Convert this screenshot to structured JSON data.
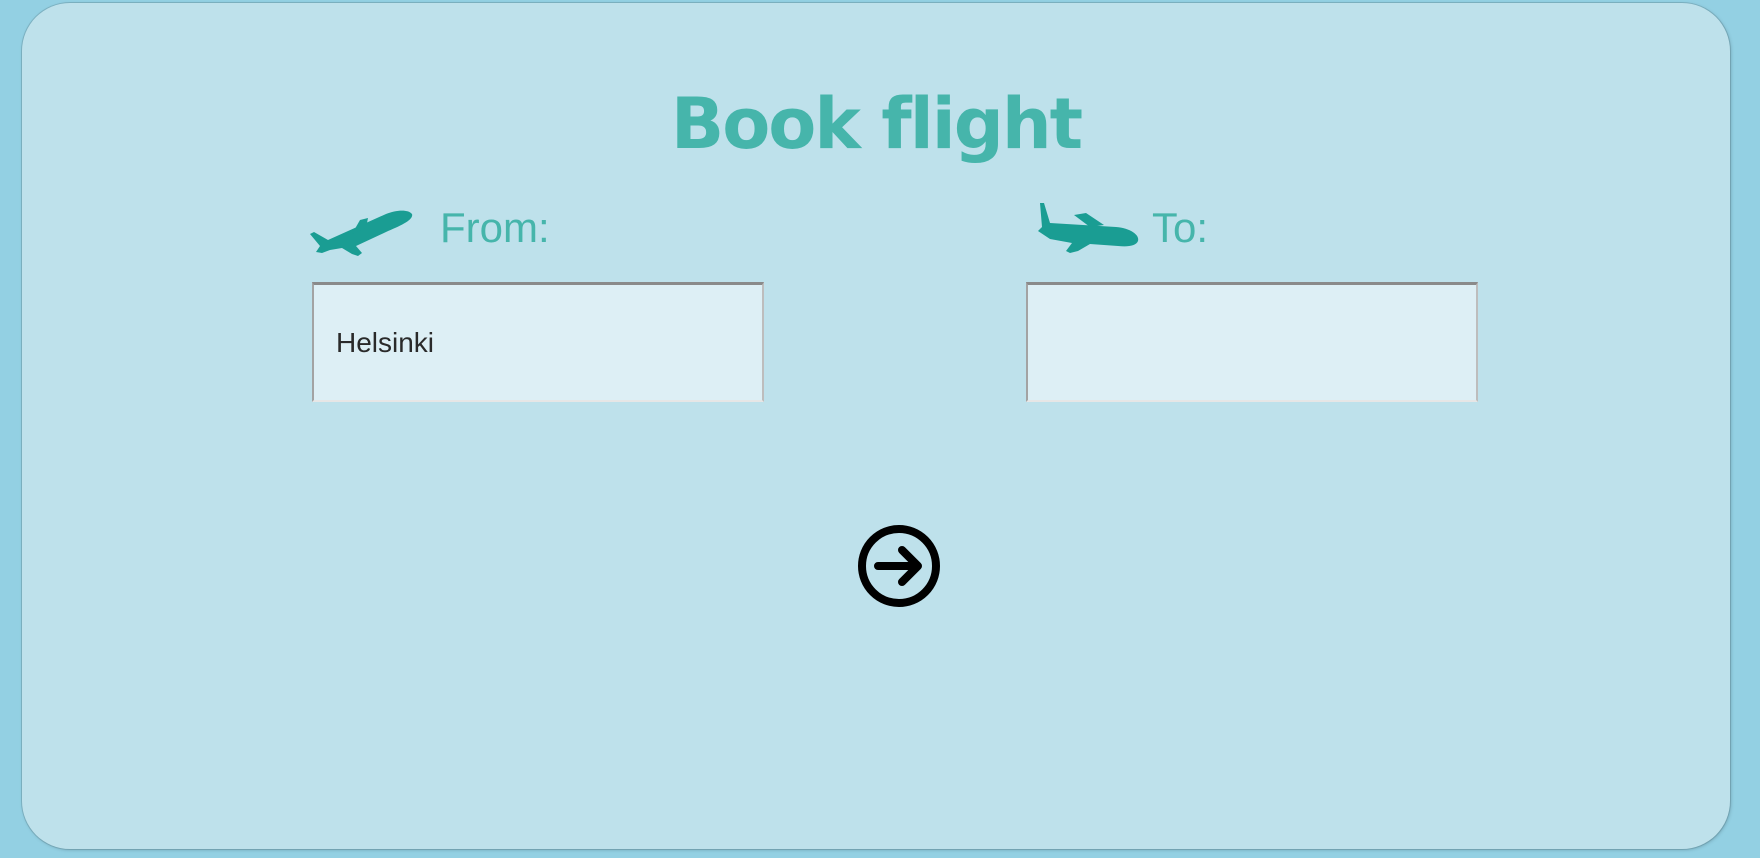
{
  "page": {
    "title": "Book flight"
  },
  "form": {
    "from": {
      "label": "From:",
      "value": "Helsinki",
      "icon": "plane-takeoff-icon"
    },
    "to": {
      "label": "To:",
      "value": "",
      "icon": "plane-landing-icon"
    },
    "submit": {
      "icon": "arrow-right-circle-icon"
    }
  },
  "colors": {
    "page_background": "#93d0e3",
    "panel_background": "#bee1eb",
    "accent_text": "#46b5ab",
    "plane_icon": "#1a9d93",
    "input_background": "#ddeff5",
    "submit_icon": "#000000"
  }
}
